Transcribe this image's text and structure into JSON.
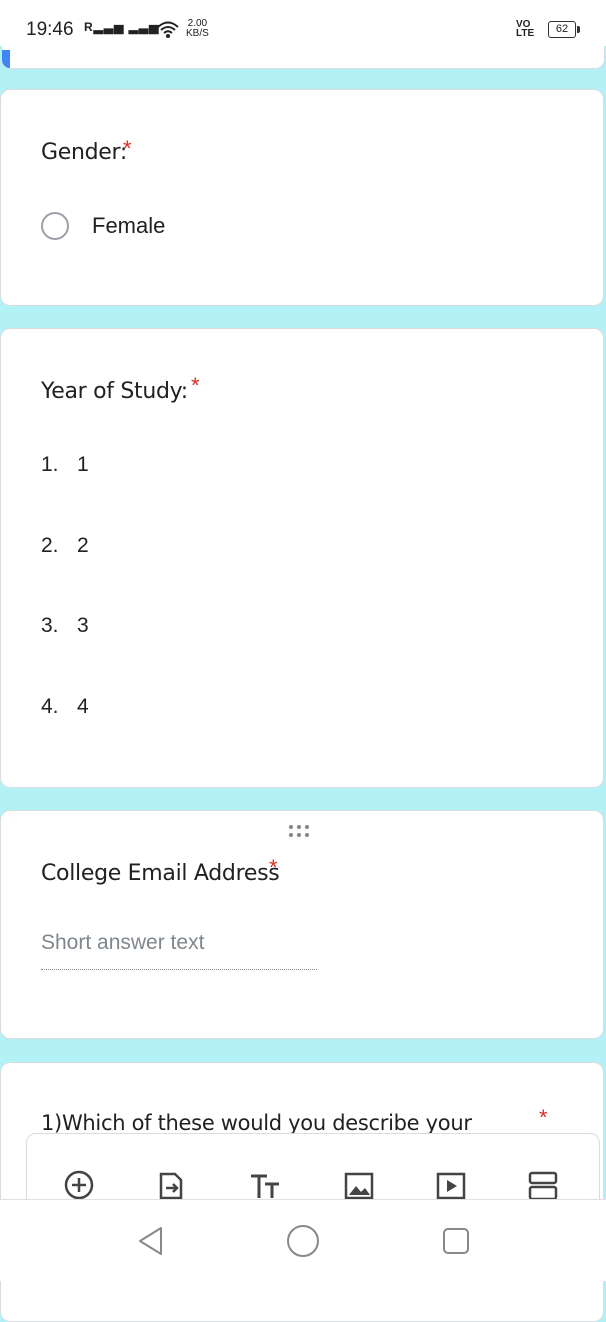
{
  "status": {
    "time": "19:46",
    "signal": "R",
    "speed_value": "2.00",
    "speed_unit": "KB/S",
    "volte_top": "VO",
    "volte_bottom": "LTE",
    "battery": "62"
  },
  "questions": [
    {
      "title": "Gender:",
      "required": "*",
      "option": "Female"
    },
    {
      "title": "Year of Study:",
      "required": "*",
      "items": [
        {
          "num": "1.",
          "label": "1"
        },
        {
          "num": "2.",
          "label": "2"
        },
        {
          "num": "3.",
          "label": "3"
        },
        {
          "num": "4.",
          "label": "4"
        }
      ]
    },
    {
      "title": "College Email Address",
      "required": "*",
      "placeholder": "Short answer text",
      "drag": "⋮⋮⋮"
    },
    {
      "title": "1)Which of these would you describe your",
      "required": "*"
    }
  ],
  "toolbar": {
    "icons": [
      "add-question-icon",
      "import-questions-icon",
      "add-title-icon",
      "add-image-icon",
      "add-video-icon",
      "add-section-icon"
    ]
  },
  "navbar": {
    "icons": [
      "back-icon",
      "home-icon",
      "recents-icon"
    ]
  },
  "colors": {
    "background": "#b2f1f5",
    "accent": "#4285f4",
    "required": "#d93025"
  }
}
